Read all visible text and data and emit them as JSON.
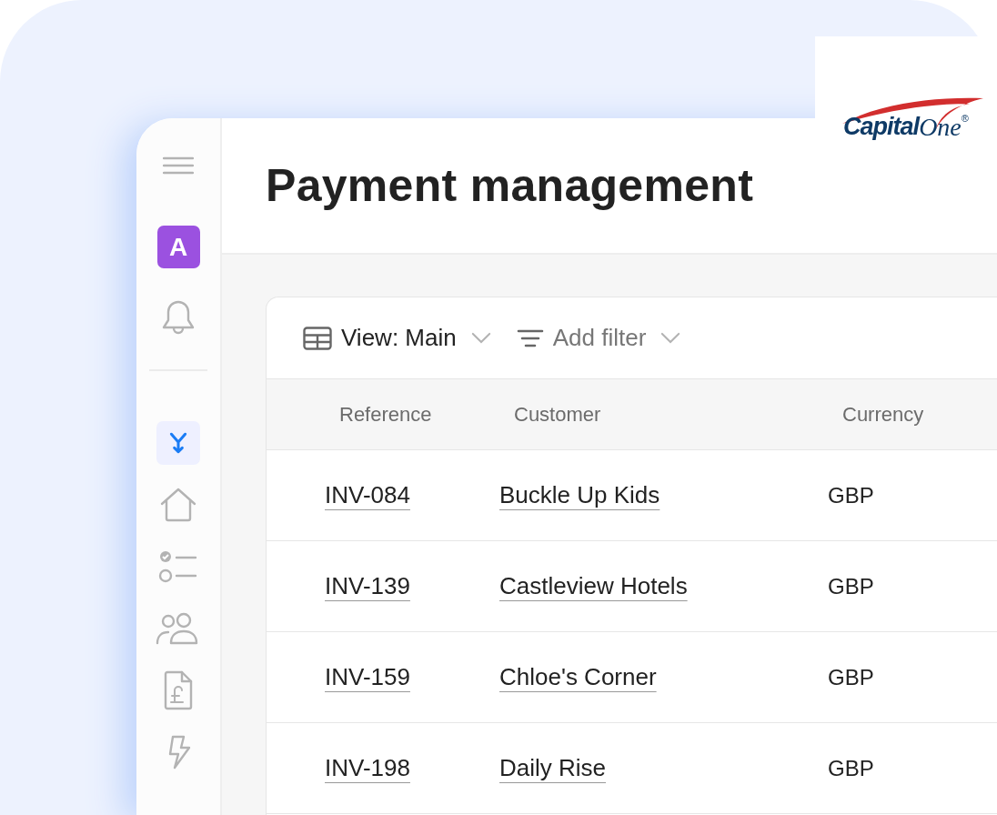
{
  "logo": {
    "text_1": "Capital",
    "text_2": "One",
    "mark": "®"
  },
  "sidebar": {
    "avatar": "A",
    "items": [
      {
        "kind": "merge",
        "selected": true
      },
      {
        "kind": "home",
        "selected": false
      },
      {
        "kind": "checklist",
        "selected": false
      },
      {
        "kind": "people",
        "selected": false
      },
      {
        "kind": "invoice",
        "selected": false
      },
      {
        "kind": "lightning",
        "selected": false
      }
    ]
  },
  "page": {
    "title": "Payment management"
  },
  "toolbar": {
    "view": "View: Main",
    "filter": "Add filter"
  },
  "table": {
    "columns": [
      "Reference",
      "Customer",
      "Currency"
    ],
    "rows": [
      {
        "reference": "INV-084",
        "customer": "Buckle Up Kids",
        "currency": "GBP"
      },
      {
        "reference": "INV-139",
        "customer": "Castleview Hotels",
        "currency": "GBP"
      },
      {
        "reference": "INV-159",
        "customer": "Chloe's Corner",
        "currency": "GBP"
      },
      {
        "reference": "INV-198",
        "customer": "Daily Rise",
        "currency": "GBP"
      }
    ]
  }
}
